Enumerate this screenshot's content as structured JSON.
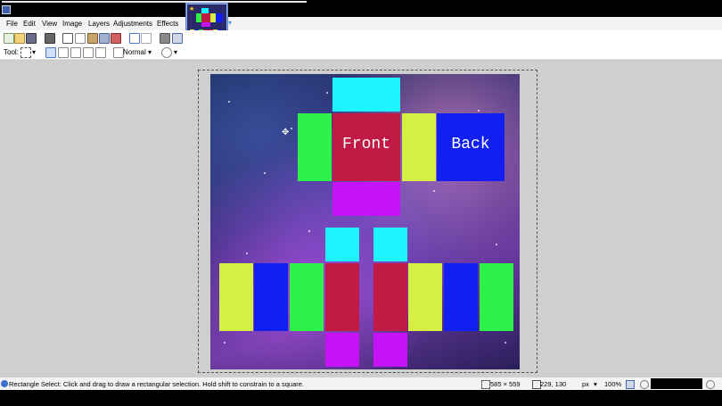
{
  "menu": {
    "items": [
      "File",
      "Edit",
      "View",
      "Image",
      "Layers",
      "Adjustments",
      "Effects"
    ]
  },
  "toolbar": {
    "tool_label": "Tool:",
    "blend_mode": "Normal"
  },
  "canvas": {
    "front_label": "Front",
    "back_label": "Back"
  },
  "status": {
    "hint": "Rectangle Select: Click and drag to draw a rectangular selection. Hold shift to constrain to a square.",
    "selection_size": "585 × 559",
    "cursor_pos": "229, 130",
    "units": "px",
    "zoom": "100%"
  },
  "colors": {
    "cyan": "#1ef4ff",
    "green": "#2cf24a",
    "crimson": "#c11a45",
    "lime": "#d5ef45",
    "blue": "#1120f0",
    "magenta": "#c513f5"
  }
}
